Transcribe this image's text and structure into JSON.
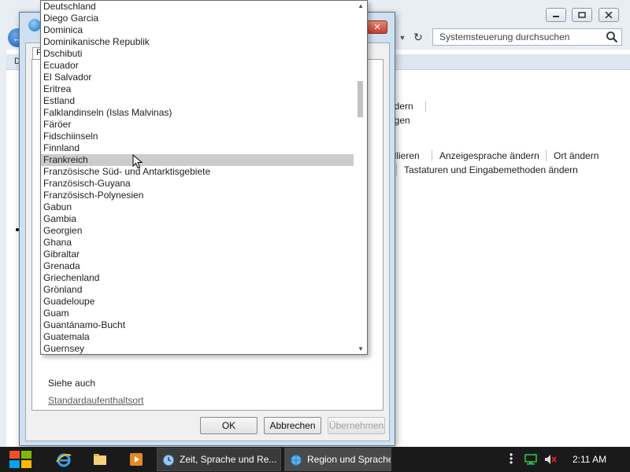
{
  "control_panel": {
    "menu_letter": "D",
    "search_placeholder": "Systemsteuerung durchsuchen",
    "links": {
      "andern": "ndern",
      "fugen": "ügen",
      "allieren": "allieren",
      "anzeigesprache": "Anzeigesprache ändern",
      "ort": "Ort ändern",
      "tastaturen": "Tastaturen und Eingabemethoden ändern"
    }
  },
  "dialog": {
    "title": "Region und Sprache",
    "tab_label": "F",
    "see_also": "Siehe auch",
    "standard_link": "Standardaufenthaltsort",
    "buttons": {
      "ok": "OK",
      "cancel": "Abbrechen",
      "apply": "Übernehmen"
    }
  },
  "dropdown": {
    "selected": "Frankreich",
    "items": [
      "Deutschland",
      "Diego Garcia",
      "Dominica",
      "Dominikanische Republik",
      "Dschibuti",
      "Ecuador",
      "El Salvador",
      "Eritrea",
      "Estland",
      "Falklandinseln (Islas Malvinas)",
      "Färöer",
      "Fidschiinseln",
      "Finnland",
      "Frankreich",
      "Französische Süd- und Antarktisgebiete",
      "Französisch-Guyana",
      "Französisch-Polynesien",
      "Gabun",
      "Gambia",
      "Georgien",
      "Ghana",
      "Gibraltar",
      "Grenada",
      "Griechenland",
      "Grönland",
      "Guadeloupe",
      "Guam",
      "Guantánamo-Bucht",
      "Guatemala",
      "Guernsey"
    ]
  },
  "taskbar": {
    "tasks": [
      {
        "label": "Zeit, Sprache und Re...",
        "icon": "clock-globe-icon"
      },
      {
        "label": "Region und Sprache",
        "icon": "globe-icon"
      }
    ],
    "clock": "2:11 AM"
  },
  "colors": {
    "selection": "#cccccc",
    "taskbar": "#1a1a1a",
    "dialog_frame": "#cfe0f1"
  }
}
